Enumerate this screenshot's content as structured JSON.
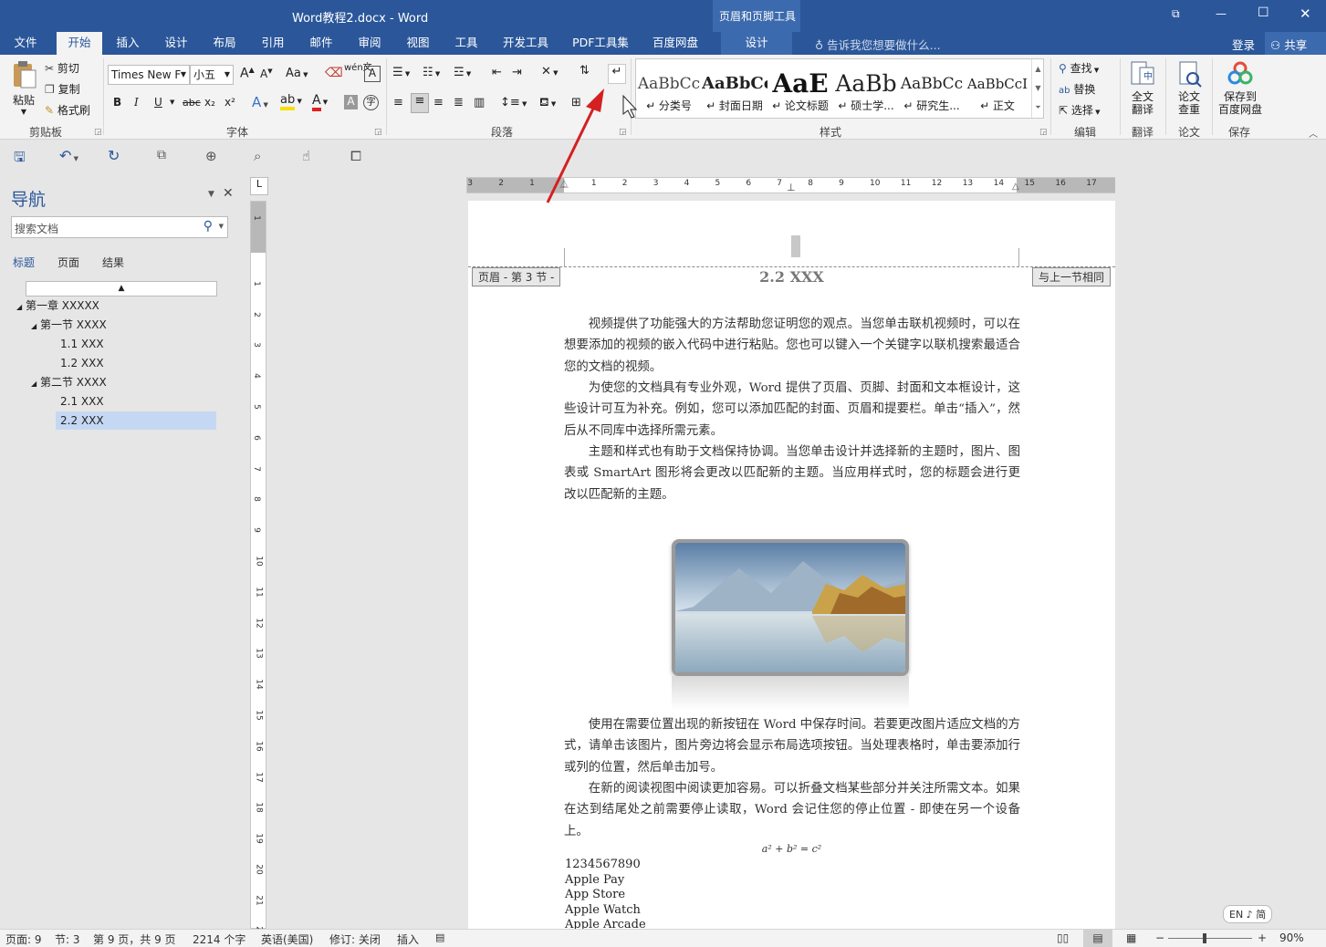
{
  "window": {
    "title": "Word教程2.docx - Word",
    "context_tab_group": "页眉和页脚工具",
    "controls": {
      "restore_ribbon": "⧉",
      "minimize": "—",
      "maximize": "☐",
      "close": "✕"
    }
  },
  "ribbon_tabs": [
    "文件",
    "开始",
    "插入",
    "设计",
    "布局",
    "引用",
    "邮件",
    "审阅",
    "视图",
    "工具",
    "开发工具",
    "PDF工具集",
    "百度网盘",
    "设计"
  ],
  "active_tab": "开始",
  "tell_me": "告诉我您想要做什么...",
  "account": {
    "login": "登录",
    "share": "共享"
  },
  "clipboard": {
    "paste": "粘贴",
    "cut": "剪切",
    "copy": "复制",
    "format_painter": "格式刷",
    "group": "剪贴板"
  },
  "font": {
    "name": "Times New F",
    "size": "小五",
    "group": "字体",
    "change_case": "Aa",
    "grow": "A",
    "shrink": "A",
    "bold": "B",
    "italic": "I",
    "underline": "U",
    "strike": "abc",
    "subscript": "x₂",
    "superscript": "x²",
    "phonetic": "wén文",
    "text_effect": "A",
    "font_color": "A",
    "shade": "A",
    "enclose": "字"
  },
  "paragraph": {
    "group": "段落"
  },
  "styles": {
    "group": "样式",
    "items": [
      {
        "sample": "AaBbCc",
        "name": "↵ 分类号"
      },
      {
        "sample": "AaBbCc",
        "name": "↵ 封面日期"
      },
      {
        "sample": "AaE",
        "name": "↵ 论文标题"
      },
      {
        "sample": "AaBb",
        "name": "↵ 硕士学..."
      },
      {
        "sample": "AaBbCc",
        "name": "↵ 研究生..."
      },
      {
        "sample": "AaBbCcI",
        "name": "↵ 正文"
      }
    ]
  },
  "editing": {
    "find": "查找",
    "replace": "替换",
    "select": "选择",
    "group": "编辑"
  },
  "translate": {
    "label1": "全文",
    "label2": "翻译",
    "group": "翻译"
  },
  "paper": {
    "label1": "论文",
    "label2": "查重",
    "group": "论文"
  },
  "save_cloud": {
    "label1": "保存到",
    "label2": "百度网盘",
    "group": "保存"
  },
  "navigation": {
    "title": "导航",
    "search_placeholder": "搜索文档",
    "tabs": [
      "标题",
      "页面",
      "结果"
    ],
    "active_tab": "标题",
    "tree": [
      {
        "label": "第一章 XXXXX",
        "level": 0,
        "expanded": true
      },
      {
        "label": "第一节 XXXX",
        "level": 1,
        "expanded": true
      },
      {
        "label": "1.1 XXX",
        "level": 2
      },
      {
        "label": "1.2 XXX",
        "level": 2
      },
      {
        "label": "第二节 XXXX",
        "level": 1,
        "expanded": true
      },
      {
        "label": "2.1 XXX",
        "level": 2
      },
      {
        "label": "2.2 XXX",
        "level": 2,
        "selected": true
      }
    ]
  },
  "ruler": {
    "horizontal_ticks": [
      "3",
      "2",
      "1",
      "1",
      "2",
      "3",
      "4",
      "5",
      "6",
      "7",
      "8",
      "9",
      "10",
      "11",
      "12",
      "13",
      "14",
      "15",
      "16",
      "17"
    ],
    "vertical_ticks": [
      "1",
      "1",
      "2",
      "3",
      "4",
      "5",
      "6",
      "7",
      "8",
      "9",
      "10",
      "11",
      "12",
      "13",
      "14",
      "15",
      "16",
      "17",
      "18",
      "19",
      "20",
      "21",
      "22"
    ],
    "corner_tab": "L"
  },
  "document": {
    "header_label": "页眉 - 第 3 节 -",
    "same_as_previous": "与上一节相同",
    "heading": "2.2 XXX",
    "paragraphs_top": [
      "视频提供了功能强大的方法帮助您证明您的观点。当您单击联机视频时，可以在想要添加的视频的嵌入代码中进行粘贴。您也可以键入一个关键字以联机搜索最适合您的文档的视频。",
      "为使您的文档具有专业外观，Word 提供了页眉、页脚、封面和文本框设计，这些设计可互为补充。例如，您可以添加匹配的封面、页眉和提要栏。单击“插入”，然后从不同库中选择所需元素。",
      "主题和样式也有助于文档保持协调。当您单击设计并选择新的主题时，图片、图表或 SmartArt 图形将会更改以匹配新的主题。当应用样式时，您的标题会进行更改以匹配新的主题。"
    ],
    "paragraphs_bottom": [
      "使用在需要位置出现的新按钮在 Word 中保存时间。若要更改图片适应文档的方式，请单击该图片，图片旁边将会显示布局选项按钮。当处理表格时，单击要添加行或列的位置，然后单击加号。",
      "在新的阅读视图中阅读更加容易。可以折叠文档某些部分并关注所需文本。如果在达到结尾处之前需要停止读取，Word 会记住您的停止位置 - 即使在另一个设备上。"
    ],
    "equation": "a² + b² = c²",
    "lines": [
      "1234567890",
      "Apple Pay",
      "App Store",
      "Apple Watch",
      "Apple Arcade"
    ]
  },
  "status": {
    "page": "页面: 9",
    "section": "节: 3",
    "page_of": "第 9 页，共 9 页",
    "words": "2214 个字",
    "language": "英语(美国)",
    "track": "修订: 关闭",
    "insert": "插入",
    "zoom": "90%",
    "ime": "EN ♪ 简"
  },
  "colors": {
    "brand": "#2b579a",
    "annotation_arrow": "#d42020",
    "nav_selected": "#c5d8f3"
  }
}
